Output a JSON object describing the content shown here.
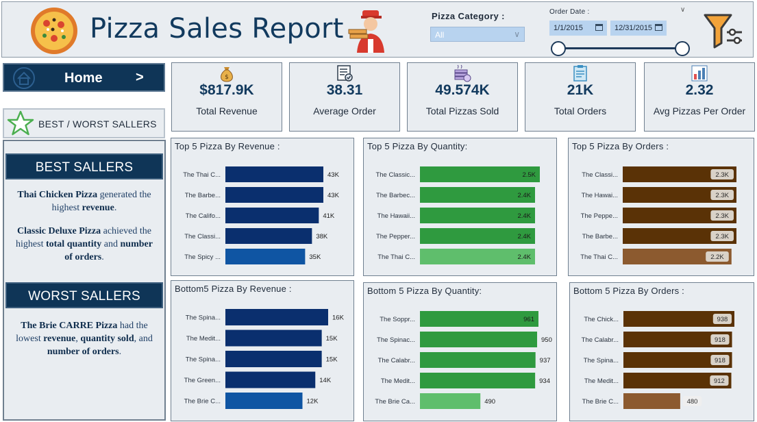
{
  "header": {
    "title": "Pizza Sales Report",
    "pizza_category": {
      "label": "Pizza Category :",
      "selected": "All"
    },
    "order_date": {
      "label": "Order Date :",
      "start": "1/1/2015",
      "end": "12/31/2015"
    },
    "icons": {
      "logo": "pizza-icon",
      "mascot": "delivery-man-icon",
      "filter": "filter-funnel-icon"
    }
  },
  "sidebar": {
    "home": {
      "label": "Home",
      "arrow": ">"
    },
    "best_worst": {
      "label": "BEST / WORST  SALLERS"
    },
    "best": {
      "heading": "BEST SALLERS",
      "line1": {
        "a": "Thai Chicken Pizza",
        "b": " generated the highest ",
        "c": "revenue",
        "d": "."
      },
      "line2": {
        "a": "Classic Deluxe Pizza",
        "b": " achieved the highest ",
        "c": "total quantity",
        "d": " and ",
        "e": "number of orders",
        "f": "."
      }
    },
    "worst": {
      "heading": "WORST SALLERS",
      "line": {
        "a": "The Brie CARRE Pizza",
        "b": " had the lowest ",
        "c": "revenue",
        "d": ", ",
        "e": "quantity sold",
        "f": ", and ",
        "g": "number of orders",
        "h": "."
      }
    }
  },
  "kpis": {
    "revenue": {
      "value": "$817.9K",
      "label": "Total Revenue",
      "icon": "money-bag-icon"
    },
    "avg_order": {
      "value": "38.31",
      "label": "Average Order",
      "icon": "order-list-icon"
    },
    "pizzas_sold": {
      "value": "49.574K",
      "label": "Total Pizzas Sold",
      "icon": "pizza-stack-icon"
    },
    "total_orders": {
      "value": "21K",
      "label": "Total Orders",
      "icon": "clipboard-icon"
    },
    "avg_pizzas": {
      "value": "2.32",
      "label": "Avg Pizzas Per Order",
      "icon": "bar-chart-icon"
    }
  },
  "colors": {
    "navy": "#0f3557",
    "revenue_dark": "#0a2f6e",
    "revenue_light": "#0f55a3",
    "quantity_dark": "#2f9a3f",
    "quantity_light": "#5fbe6c",
    "orders_dark": "#5a3206",
    "orders_light": "#8c5a2f"
  },
  "chart_data": [
    {
      "id": "top_revenue",
      "type": "bar",
      "orientation": "horizontal",
      "title": "Top 5 Pizza By Revenue :",
      "categories": [
        "The Thai C...",
        "The Barbe...",
        "The Califo...",
        "The Classi...",
        "The Spicy ..."
      ],
      "values": [
        43,
        43,
        41,
        38,
        35
      ],
      "value_labels": [
        "43K",
        "43K",
        "41K",
        "38K",
        "35K"
      ],
      "xlim": [
        0,
        43
      ],
      "label_position": "outside"
    },
    {
      "id": "top_quantity",
      "type": "bar",
      "orientation": "horizontal",
      "title": "Top 5 Pizza By Quantity:",
      "categories": [
        "The Classic...",
        "The Barbec...",
        "The Hawaii...",
        "The Pepper...",
        "The Thai C..."
      ],
      "values": [
        2.5,
        2.4,
        2.4,
        2.4,
        2.4
      ],
      "value_labels": [
        "2.5K",
        "2.4K",
        "2.4K",
        "2.4K",
        "2.4K"
      ],
      "xlim": [
        0,
        2.5
      ],
      "label_position": "inside"
    },
    {
      "id": "top_orders",
      "type": "bar",
      "orientation": "horizontal",
      "title": "Top 5 Pizza By Orders :",
      "categories": [
        "The Classi...",
        "The Hawai...",
        "The Peppe...",
        "The Barbe...",
        "The Thai C..."
      ],
      "values": [
        2.3,
        2.3,
        2.3,
        2.3,
        2.2
      ],
      "value_labels": [
        "2.3K",
        "2.3K",
        "2.3K",
        "2.3K",
        "2.2K"
      ],
      "xlim": [
        0,
        2.3
      ],
      "label_position": "inside"
    },
    {
      "id": "bottom_revenue",
      "type": "bar",
      "orientation": "horizontal",
      "title": "Bottom5 Pizza By Revenue :",
      "categories": [
        "The Spina...",
        "The Medit...",
        "The Spina...",
        "The Green...",
        "The Brie C..."
      ],
      "values": [
        16,
        15,
        15,
        14,
        12
      ],
      "value_labels": [
        "16K",
        "15K",
        "15K",
        "14K",
        "12K"
      ],
      "xlim": [
        0,
        16
      ],
      "label_position": "outside"
    },
    {
      "id": "bottom_quantity",
      "type": "bar",
      "orientation": "horizontal",
      "title": "Bottom 5 Pizza By Quantity:",
      "categories": [
        "The Soppr...",
        "The Spinac...",
        "The Calabr...",
        "The Medit...",
        "The Brie Ca..."
      ],
      "values": [
        961,
        950,
        937,
        934,
        490
      ],
      "value_labels": [
        "961",
        "950",
        "937",
        "934",
        "490"
      ],
      "xlim": [
        0,
        961
      ],
      "label_position": "mixed"
    },
    {
      "id": "bottom_orders",
      "type": "bar",
      "orientation": "horizontal",
      "title": "Bottom 5 Pizza By Orders :",
      "categories": [
        "The Chick...",
        "The Calabr...",
        "The Spina...",
        "The Medit...",
        "The Brie C..."
      ],
      "values": [
        938,
        918,
        918,
        912,
        480
      ],
      "value_labels": [
        "938",
        "918",
        "918",
        "912",
        "480"
      ],
      "xlim": [
        0,
        938
      ],
      "label_position": "mixed"
    }
  ]
}
